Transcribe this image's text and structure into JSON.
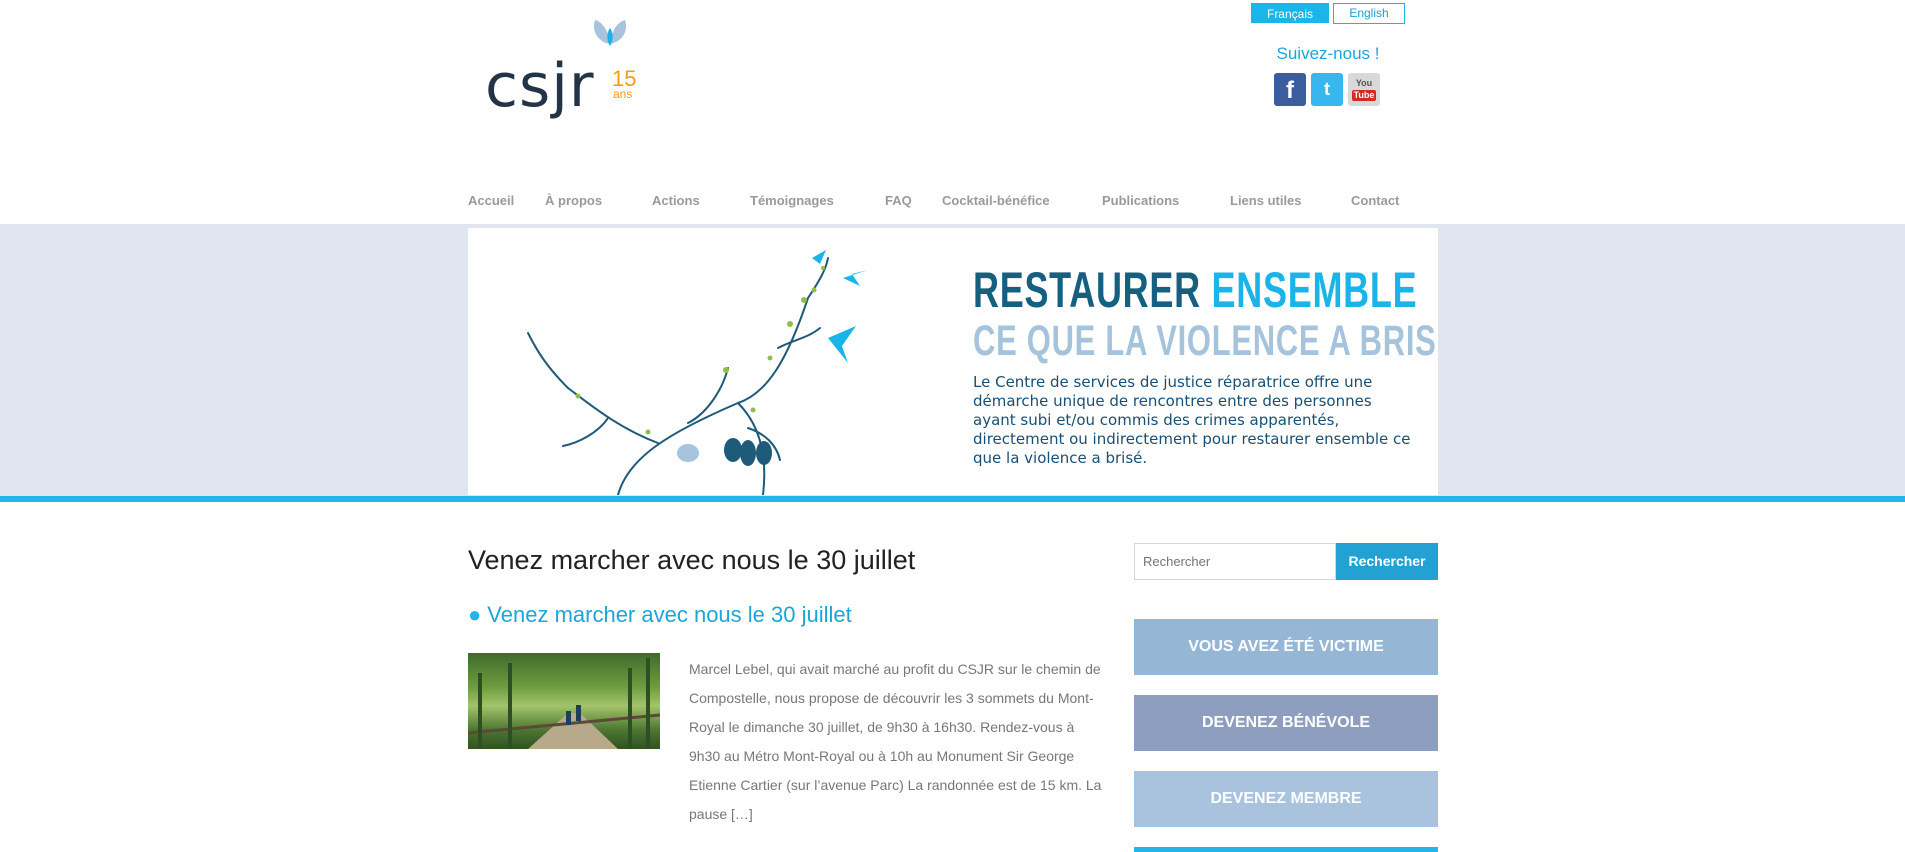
{
  "logo": {
    "text": "csjr",
    "number": "15",
    "suffix": "ans"
  },
  "language": {
    "fr": "Français",
    "en": "English"
  },
  "social": {
    "heading": "Suivez-nous !",
    "facebook": "f",
    "twitter": "t",
    "youtube_top": "You",
    "youtube_bottom": "Tube"
  },
  "nav": [
    "Accueil",
    "À propos",
    "Actions",
    "Témoignages",
    "FAQ",
    "Cocktail-bénéfice",
    "Publications",
    "Liens utiles",
    "Contact"
  ],
  "banner": {
    "title_part1": "RESTAURER ",
    "title_part2": "ENSEMBLE",
    "subtitle": "CE QUE LA VIOLENCE A BRISÉ",
    "description": "Le Centre de services de justice réparatrice offre une démarche unique de rencontres entre des personnes ayant subi et/ou commis des crimes apparentés, directement ou indirectement pour restaurer ensemble ce que la violence a brisé."
  },
  "main": {
    "page_title": "Venez marcher avec nous le 30 juillet",
    "post_title": "Venez marcher avec nous le 30 juillet",
    "excerpt": "Marcel Lebel, qui avait marché au profit du CSJR sur le chemin de Compostelle, nous propose de découvrir les 3 sommets du Mont-Royal le dimanche 30 juillet, de 9h30 à 16h30. Rendez-vous à 9h30 au Métro Mont-Royal ou à 10h au Monument Sir George Etienne Cartier (sur l’avenue Parc) La randonnée est de 15 km. La pause […]"
  },
  "sidebar": {
    "search_placeholder": "Rechercher",
    "search_button": "Rechercher",
    "cta_victim": "VOUS AVEZ ÉTÉ VICTIME",
    "cta_volunteer": "DEVENEZ BÉNÉVOLE",
    "cta_member": "DEVENEZ MEMBRE"
  },
  "colors": {
    "accent": "#23b5e8",
    "dark": "#155f80",
    "band": "#e1e5ef"
  }
}
